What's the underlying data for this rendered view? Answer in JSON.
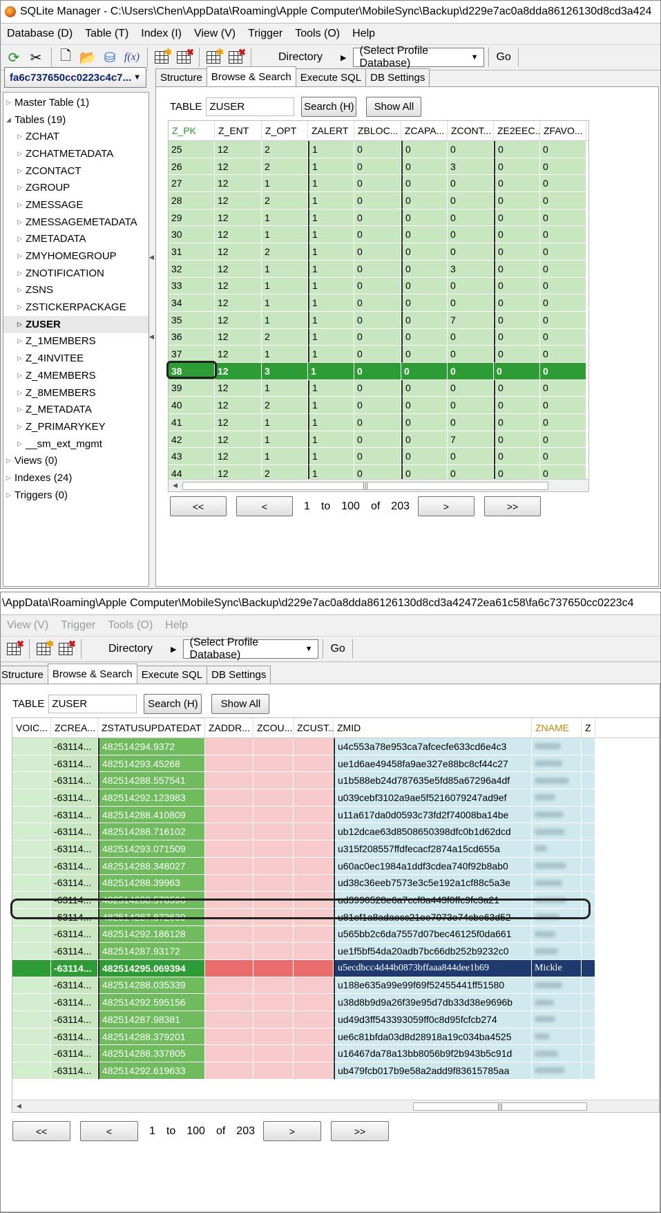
{
  "p1": {
    "title": "SQLite Manager - C:\\Users\\Chen\\AppData\\Roaming\\Apple Computer\\MobileSync\\Backup\\d229e7ac0a8dda86126130d8cd3a424",
    "menu": [
      "Database (D)",
      "Table (T)",
      "Index (I)",
      "View (V)",
      "Trigger",
      "Tools (O)",
      "Help"
    ],
    "directory_label": "Directory",
    "profile_select": "(Select Profile Database)",
    "go": "Go",
    "db_select": "fa6c737650cc0223c4c7...",
    "tree": [
      {
        "label": "Master Table (1)",
        "level": 0,
        "open": false
      },
      {
        "label": "Tables (19)",
        "level": 0,
        "open": true
      },
      {
        "label": "ZCHAT",
        "level": 1
      },
      {
        "label": "ZCHATMETADATA",
        "level": 1
      },
      {
        "label": "ZCONTACT",
        "level": 1
      },
      {
        "label": "ZGROUP",
        "level": 1
      },
      {
        "label": "ZMESSAGE",
        "level": 1
      },
      {
        "label": "ZMESSAGEMETADATA",
        "level": 1
      },
      {
        "label": "ZMETADATA",
        "level": 1
      },
      {
        "label": "ZMYHOMEGROUP",
        "level": 1
      },
      {
        "label": "ZNOTIFICATION",
        "level": 1
      },
      {
        "label": "ZSNS",
        "level": 1
      },
      {
        "label": "ZSTICKERPACKAGE",
        "level": 1
      },
      {
        "label": "ZUSER",
        "level": 1,
        "selected": true
      },
      {
        "label": "Z_1MEMBERS",
        "level": 1
      },
      {
        "label": "Z_4INVITEE",
        "level": 1
      },
      {
        "label": "Z_4MEMBERS",
        "level": 1
      },
      {
        "label": "Z_8MEMBERS",
        "level": 1
      },
      {
        "label": "Z_METADATA",
        "level": 1
      },
      {
        "label": "Z_PRIMARYKEY",
        "level": 1
      },
      {
        "label": "__sm_ext_mgmt",
        "level": 1
      },
      {
        "label": "Views (0)",
        "level": 0,
        "open": false
      },
      {
        "label": "Indexes (24)",
        "level": 0,
        "open": false
      },
      {
        "label": "Triggers (0)",
        "level": 0,
        "open": false
      }
    ],
    "tabs": [
      "Structure",
      "Browse & Search",
      "Execute SQL",
      "DB Settings"
    ],
    "table_label": "TABLE",
    "table_value": "ZUSER",
    "search_btn": "Search (H)",
    "showall_btn": "Show All",
    "columns": [
      "Z_PK",
      "Z_ENT",
      "Z_OPT",
      "ZALERT",
      "ZBLOC...",
      "ZCAPA...",
      "ZCONT...",
      "ZE2EEC...",
      "ZFAVO..."
    ],
    "rows": [
      [
        "25",
        "12",
        "2",
        "1",
        "0",
        "0",
        "0",
        "0",
        "0"
      ],
      [
        "26",
        "12",
        "2",
        "1",
        "0",
        "0",
        "3",
        "0",
        "0"
      ],
      [
        "27",
        "12",
        "1",
        "1",
        "0",
        "0",
        "0",
        "0",
        "0"
      ],
      [
        "28",
        "12",
        "2",
        "1",
        "0",
        "0",
        "0",
        "0",
        "0"
      ],
      [
        "29",
        "12",
        "1",
        "1",
        "0",
        "0",
        "0",
        "0",
        "0"
      ],
      [
        "30",
        "12",
        "1",
        "1",
        "0",
        "0",
        "0",
        "0",
        "0"
      ],
      [
        "31",
        "12",
        "2",
        "1",
        "0",
        "0",
        "0",
        "0",
        "0"
      ],
      [
        "32",
        "12",
        "1",
        "1",
        "0",
        "0",
        "3",
        "0",
        "0"
      ],
      [
        "33",
        "12",
        "1",
        "1",
        "0",
        "0",
        "0",
        "0",
        "0"
      ],
      [
        "34",
        "12",
        "1",
        "1",
        "0",
        "0",
        "0",
        "0",
        "0"
      ],
      [
        "35",
        "12",
        "1",
        "1",
        "0",
        "0",
        "7",
        "0",
        "0"
      ],
      [
        "36",
        "12",
        "2",
        "1",
        "0",
        "0",
        "0",
        "0",
        "0"
      ],
      [
        "37",
        "12",
        "1",
        "1",
        "0",
        "0",
        "0",
        "0",
        "0"
      ],
      [
        "38",
        "12",
        "3",
        "1",
        "0",
        "0",
        "0",
        "0",
        "0"
      ],
      [
        "39",
        "12",
        "1",
        "1",
        "0",
        "0",
        "0",
        "0",
        "0"
      ],
      [
        "40",
        "12",
        "2",
        "1",
        "0",
        "0",
        "0",
        "0",
        "0"
      ],
      [
        "41",
        "12",
        "1",
        "1",
        "0",
        "0",
        "0",
        "0",
        "0"
      ],
      [
        "42",
        "12",
        "1",
        "1",
        "0",
        "0",
        "7",
        "0",
        "0"
      ],
      [
        "43",
        "12",
        "1",
        "1",
        "0",
        "0",
        "0",
        "0",
        "0"
      ],
      [
        "44",
        "12",
        "2",
        "1",
        "0",
        "0",
        "0",
        "0",
        "0"
      ]
    ],
    "selected_row": 13,
    "scroll_glyph": "|||",
    "pager": {
      "first": "<<",
      "prev": "<",
      "next": ">",
      "last": ">>",
      "from": "1",
      "to_word": "to",
      "to": "100",
      "of_word": "of",
      "total": "203"
    }
  },
  "p2": {
    "title": "\\AppData\\Roaming\\Apple Computer\\MobileSync\\Backup\\d229e7ac0a8dda86126130d8cd3a42472ea61c58\\fa6c737650cc0223c4",
    "menu": [
      "View (V)",
      "Trigger",
      "Tools (O)",
      "Help"
    ],
    "directory_label": "Directory",
    "profile_select": "(Select Profile Database)",
    "go": "Go",
    "tabs": [
      "Structure",
      "Browse & Search",
      "Execute SQL",
      "DB Settings"
    ],
    "table_label": "TABLE",
    "table_value": "ZUSER",
    "search_btn": "Search (H)",
    "showall_btn": "Show All",
    "columns": [
      "VOIC...",
      "ZCREA...",
      "ZSTATUSUPDATEDAT",
      "ZADDR...",
      "ZCOU...",
      "ZCUST...",
      "ZMID",
      "ZNAME",
      "Z"
    ],
    "rows": [
      [
        "-63114...",
        "482514294.9372",
        "u4c553a78e953ca7afcecfe633cd6e4c3"
      ],
      [
        "-63114...",
        "482514293.45268",
        "ue1d6ae49458fa9ae327e88bc8cf44c27"
      ],
      [
        "-63114...",
        "482514288.557541",
        "u1b588eb24d787635e5fd85a67296a4df"
      ],
      [
        "-63114...",
        "482514292.123983",
        "u039cebf3102a9ae5f5216079247ad9ef"
      ],
      [
        "-63114...",
        "482514288.410809",
        "u11a617da0d0593c73fd2f74008ba14be"
      ],
      [
        "-63114...",
        "482514288.716102",
        "ub12dcae63d8508650398dfc0b1d62dcd"
      ],
      [
        "-63114...",
        "482514293.071509",
        "u315f208557ffdfecacf2874a15cd655a"
      ],
      [
        "-63114...",
        "482514288.348027",
        "u60ac0ec1984a1ddf3cdea740f92b8ab0"
      ],
      [
        "-63114...",
        "482514288.39963",
        "ud38c36eeb7573e3c5e192a1cf88c5a3e"
      ],
      [
        "-63114...",
        "482514288.578596",
        "ud3990528e6a7ccf8a443f0ffc9fc3a21"
      ],
      [
        "-63114...",
        "482514287.872639",
        "u81ef1a8adaecc21ee7073e74cbe63d52"
      ],
      [
        "-63114...",
        "482514292.186128",
        "u565bb2c6da7557d07bec46125f0da661"
      ],
      [
        "-63114...",
        "482514287.93172",
        "ue1f5bf54da20adb7bc66db252b9232c0"
      ],
      [
        "-63114...",
        "482514295.069394",
        "u5ecdbcc4d44b0873bffaaa844dee1b69"
      ],
      [
        "-63114...",
        "482514288.035339",
        "u188e635a99e99f69f52455441ff51580"
      ],
      [
        "-63114...",
        "482514292.595156",
        "u38d8b9d9a26f39e95d7db33d38e9696b"
      ],
      [
        "-63114...",
        "482514287.98381",
        "ud49d3ff543393059ff0c8d95fcfcb274"
      ],
      [
        "-63114...",
        "482514288.379201",
        "ue6c81bfda03d8d28918a19c034ba4525"
      ],
      [
        "-63114...",
        "482514288.337805",
        "u16467da78a13bb8056b9f2b943b5c91d"
      ],
      [
        "-63114...",
        "482514292.619633",
        "ub479fcb017b9e58a2add9f83615785aa"
      ]
    ],
    "selected_row": 13,
    "selected_name": "Mickle",
    "scroll_glyph": "|||",
    "pager": {
      "first": "<<",
      "prev": "<",
      "next": ">",
      "last": ">>",
      "from": "1",
      "to_word": "to",
      "to": "100",
      "of_word": "of",
      "total": "203"
    }
  },
  "colors": {
    "green_cell": "#c8e6c0",
    "selected_green": "#2e9c35",
    "pink_cell": "#f7cacb",
    "blue_cell": "#cfe9ee",
    "selected_blue": "#1f3a6e"
  }
}
